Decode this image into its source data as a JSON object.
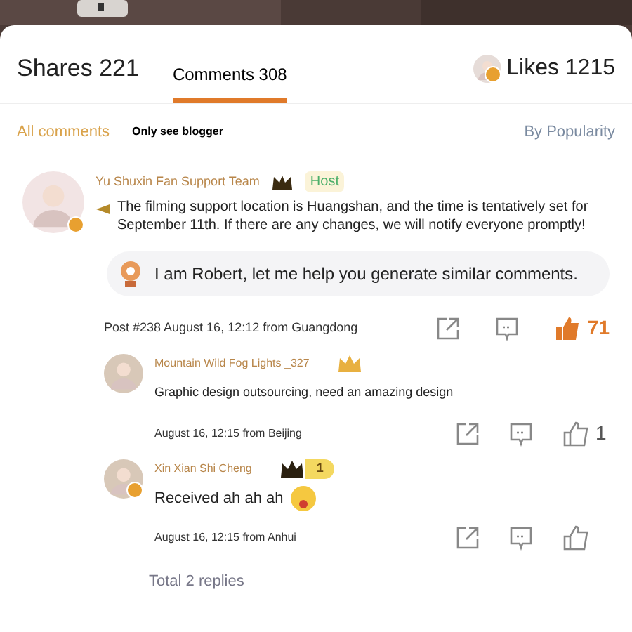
{
  "header_tabs": [
    {
      "label": "Shares 221",
      "selected": false
    },
    {
      "label": "Comments 308",
      "selected": true
    }
  ],
  "likes": {
    "label": "Likes 1215"
  },
  "filters": [
    {
      "label": "All comments",
      "selected": true
    },
    {
      "label": "Only see blogger",
      "selected": false
    }
  ],
  "sort": {
    "label": "By Popularity"
  },
  "post": {
    "author": "Yu Shuxin Fan Support Team",
    "badge": "Host",
    "verified": true,
    "text": "The filming support location is Huangshan, and the time is tentatively set for September 11th. If there are any changes, we will notify everyone promptly!",
    "assistant": "I am Robert, let me help you generate similar comments.",
    "meta": "Post #238 August 16, 12:12 from Guangdong",
    "likes": "71",
    "liked": true
  },
  "replies": [
    {
      "author": "Mountain Wild Fog Lights _327",
      "text": "Graphic design outsourcing, need an amazing design",
      "emoji": false,
      "meta": "August 16, 12:15 from Beijing",
      "likes": "1",
      "liked": false,
      "verified": false
    },
    {
      "author": "Xin Xian Shi Cheng",
      "text": "Received ah ah ah",
      "emoji": true,
      "level": "1",
      "meta": "August 16, 12:15 from Anhui",
      "liked": false,
      "verified": true
    }
  ],
  "total": "Total 2 replies"
}
